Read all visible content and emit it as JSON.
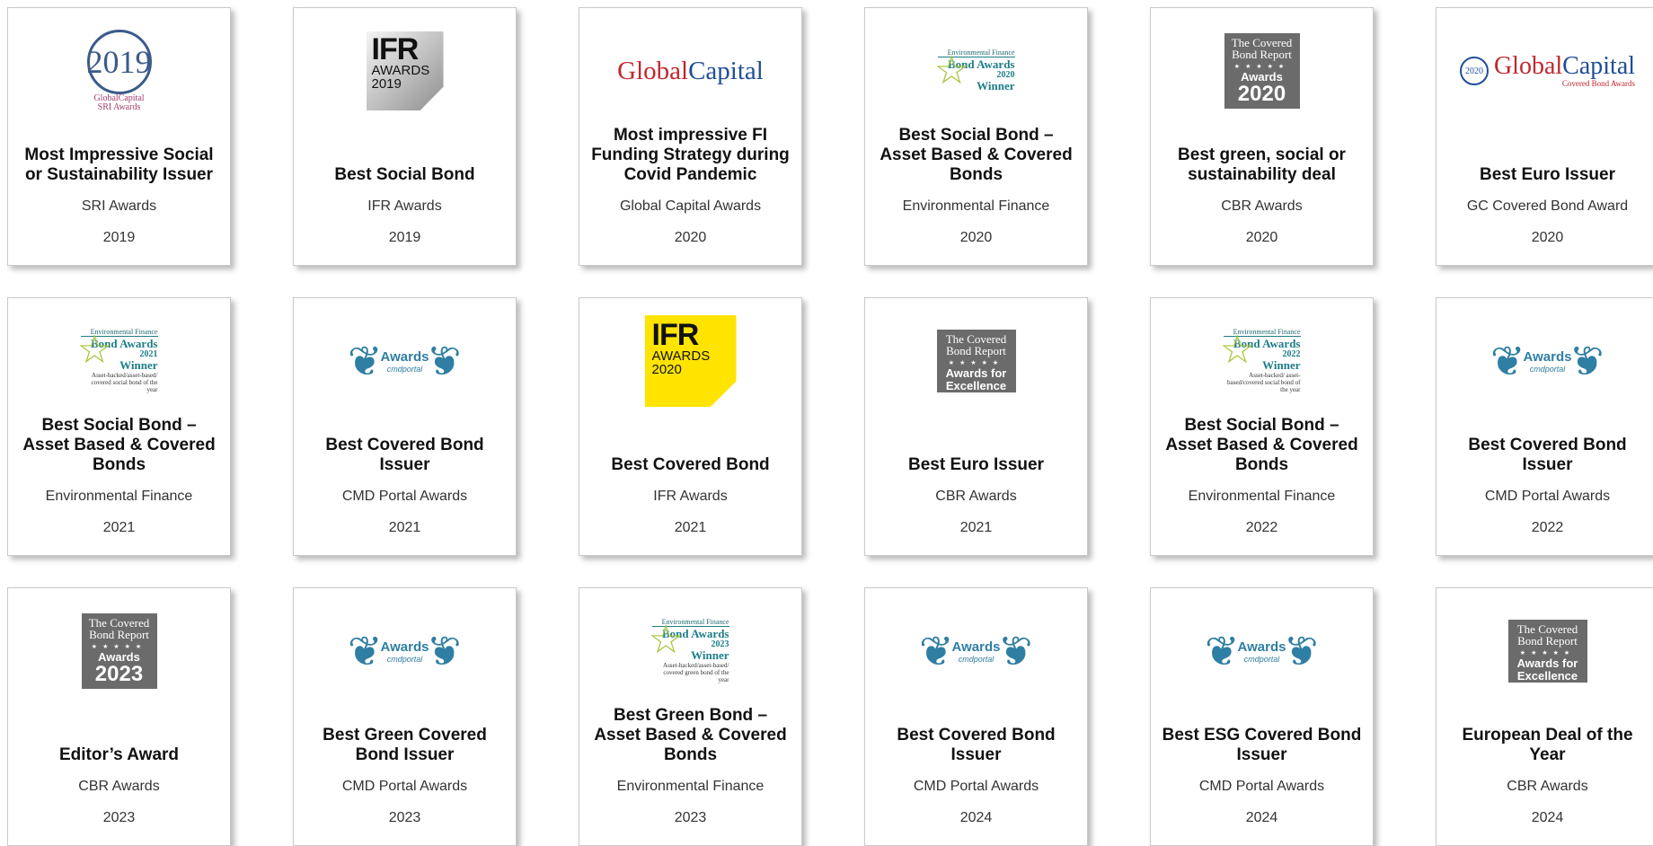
{
  "awards": [
    {
      "logo": {
        "type": "sri",
        "year": "2019",
        "line1": "GlobalCapital",
        "line2": "SRI Awards"
      },
      "title": "Most Impressive Social or Sustainability Issuer",
      "org": "SRI Awards",
      "year": "2019"
    },
    {
      "logo": {
        "type": "ifr",
        "big": "IFR",
        "line1": "AWARDS",
        "line2": "2019",
        "color": "#a8a8a8"
      },
      "title": "Best Social Bond",
      "org": "IFR Awards",
      "year": "2019"
    },
    {
      "logo": {
        "type": "gc",
        "g1": "Global",
        "g2": "Capital"
      },
      "title": "Most impressive FI Funding Strategy during Covid Pandemic",
      "org": "Global Capital Awards",
      "year": "2020"
    },
    {
      "logo": {
        "type": "ef",
        "head": "Environmental Finance",
        "name": "Bond Awards",
        "year": "2020",
        "win": "Winner",
        "cat": ""
      },
      "title": "Best Social Bond – Asset Based & Covered Bonds",
      "org": "Environmental Finance",
      "year": "2020"
    },
    {
      "logo": {
        "type": "cbr",
        "top": "The Covered Bond Report",
        "mid": "Awards",
        "yr": "2020"
      },
      "title": "Best green, social or sustainability deal",
      "org": "CBR Awards",
      "year": "2020"
    },
    {
      "logo": {
        "type": "gcb",
        "badge": "2020",
        "name": "GlobalCapital",
        "sub": "Covered Bond Awards"
      },
      "title": "Best Euro Issuer",
      "org": "GC Covered Bond Award",
      "year": "2020"
    },
    {
      "logo": {
        "type": "ef",
        "head": "Environmental Finance",
        "name": "Bond Awards",
        "year": "2021",
        "win": "Winner",
        "cat": "Asset-backed/asset-based/ covered social bond of the year"
      },
      "title": "Best Social Bond – Asset Based & Covered Bonds",
      "org": "Environmental Finance",
      "year": "2021"
    },
    {
      "logo": {
        "type": "cmd",
        "word": "Awards",
        "sub": "cmdportal"
      },
      "title": "Best Covered Bond Issuer",
      "org": "CMD Portal Awards",
      "year": "2021"
    },
    {
      "logo": {
        "type": "ifr",
        "big": "IFR",
        "line1": "AWARDS",
        "line2": "2020",
        "color": "#ffe400"
      },
      "title": "Best Covered Bond",
      "org": "IFR Awards",
      "year": "2021"
    },
    {
      "logo": {
        "type": "cbr",
        "top": "The Covered Bond Report",
        "mid": "Awards for Excellence",
        "yr": ""
      },
      "title": "Best Euro Issuer",
      "org": "CBR Awards",
      "year": "2021"
    },
    {
      "logo": {
        "type": "ef",
        "head": "Environmental Finance",
        "name": "Bond Awards",
        "year": "2022",
        "win": "Winner",
        "cat": "Asset-backed/ asset-based/covered social bond of the year"
      },
      "title": "Best Social Bond – Asset Based & Covered Bonds",
      "org": "Environmental Finance",
      "year": "2022"
    },
    {
      "logo": {
        "type": "cmd",
        "word": "Awards",
        "sub": "cmdportal"
      },
      "title": "Best Covered Bond Issuer",
      "org": "CMD Portal Awards",
      "year": "2022"
    },
    {
      "logo": {
        "type": "cbr",
        "top": "The Covered Bond Report",
        "mid": "Awards",
        "yr": "2023"
      },
      "title": "Editor’s Award",
      "org": "CBR Awards",
      "year": "2023"
    },
    {
      "logo": {
        "type": "cmd",
        "word": "Awards",
        "sub": "cmdportal"
      },
      "title": "Best Green Covered Bond Issuer",
      "org": "CMD Portal Awards",
      "year": "2023"
    },
    {
      "logo": {
        "type": "ef",
        "head": "Environmental Finance",
        "name": "Bond Awards",
        "year": "2023",
        "win": "Winner",
        "cat": "Asset-backed/asset-based/ covered green bond of the year"
      },
      "title": "Best Green Bond – Asset Based & Covered Bonds",
      "org": "Environmental Finance",
      "year": "2023"
    },
    {
      "logo": {
        "type": "cmd",
        "word": "Awards",
        "sub": "cmdportal"
      },
      "title": "Best Covered Bond Issuer",
      "org": "CMD Portal Awards",
      "year": "2024"
    },
    {
      "logo": {
        "type": "cmd",
        "word": "Awards",
        "sub": "cmdportal"
      },
      "title": "Best ESG Covered Bond Issuer",
      "org": "CMD Portal Awards",
      "year": "2024"
    },
    {
      "logo": {
        "type": "cbr",
        "top": "The Covered Bond Report",
        "mid": "Awards for Excellence",
        "yr": ""
      },
      "title": "European Deal of the Year",
      "org": "CBR Awards",
      "year": "2024"
    }
  ]
}
